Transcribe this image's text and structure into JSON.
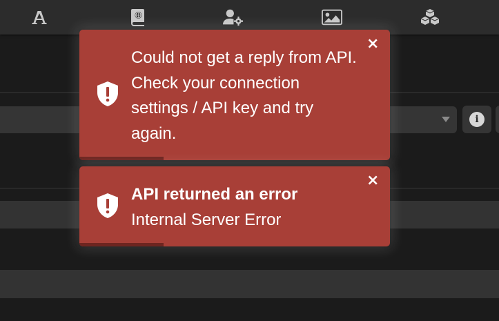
{
  "nav": {
    "icons": [
      {
        "name": "font-icon"
      },
      {
        "name": "book-icon"
      },
      {
        "name": "user-settings-icon"
      },
      {
        "name": "image-icon"
      },
      {
        "name": "cubes-icon"
      }
    ]
  },
  "background": {
    "info_button_glyph": "i"
  },
  "toasts": [
    {
      "title": "",
      "message": "Could not get a reply from API. Check your connection settings / API key and try again.",
      "close_glyph": "×",
      "progress": 0.27
    },
    {
      "title": "API returned an error",
      "message": "Internal Server Error",
      "close_glyph": "×",
      "progress": 0.27
    }
  ],
  "colors": {
    "toast_background": "#a83f37",
    "toast_progress": "#6e2520",
    "app_background": "#1b1b1b",
    "topbar_background": "#2c2c2c",
    "icon_color": "#c8c8c8"
  }
}
